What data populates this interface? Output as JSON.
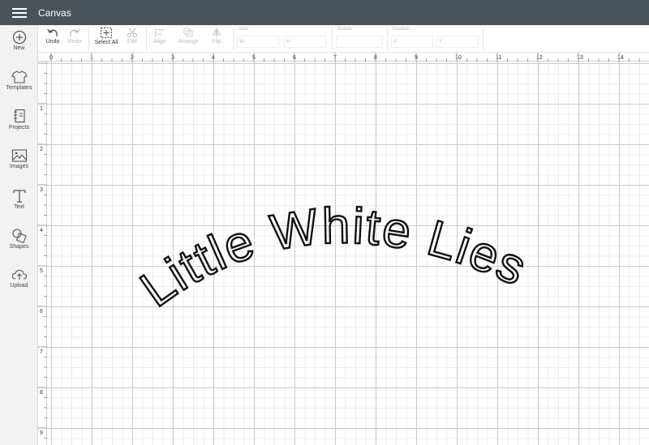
{
  "header": {
    "title": "Canvas"
  },
  "sidebar": {
    "items": [
      {
        "label": "New",
        "icon": "plus-circle-icon"
      },
      {
        "label": "Templates",
        "icon": "shirt-icon"
      },
      {
        "label": "Projects",
        "icon": "notebook-icon"
      },
      {
        "label": "Images",
        "icon": "image-icon"
      },
      {
        "label": "Text",
        "icon": "text-t-icon"
      },
      {
        "label": "Shapes",
        "icon": "shapes-icon"
      },
      {
        "label": "Upload",
        "icon": "cloud-upload-icon"
      }
    ]
  },
  "toolbar": {
    "undo_label": "Undo",
    "redo_label": "Redo",
    "select_all_label": "Select All",
    "edit_label": "Edit",
    "align_label": "Align",
    "arrange_label": "Arrange",
    "flip_label": "Flip",
    "size_label": "Size",
    "size_w": "W",
    "size_h": "H",
    "rotate_label": "Rotate",
    "position_label": "Position",
    "position_x": "X",
    "position_y": "Y"
  },
  "ruler": {
    "top": [
      "0",
      "1",
      "2",
      "3",
      "4",
      "5",
      "6",
      "7",
      "8",
      "9",
      "10",
      "11",
      "12",
      "13",
      "14"
    ],
    "left": [
      "1",
      "2",
      "3",
      "4",
      "5",
      "6",
      "7",
      "8",
      "9"
    ]
  },
  "canvas": {
    "design_text": "Little White Lies",
    "text_color": "#111111",
    "grid_color": "#c9c9c9"
  }
}
